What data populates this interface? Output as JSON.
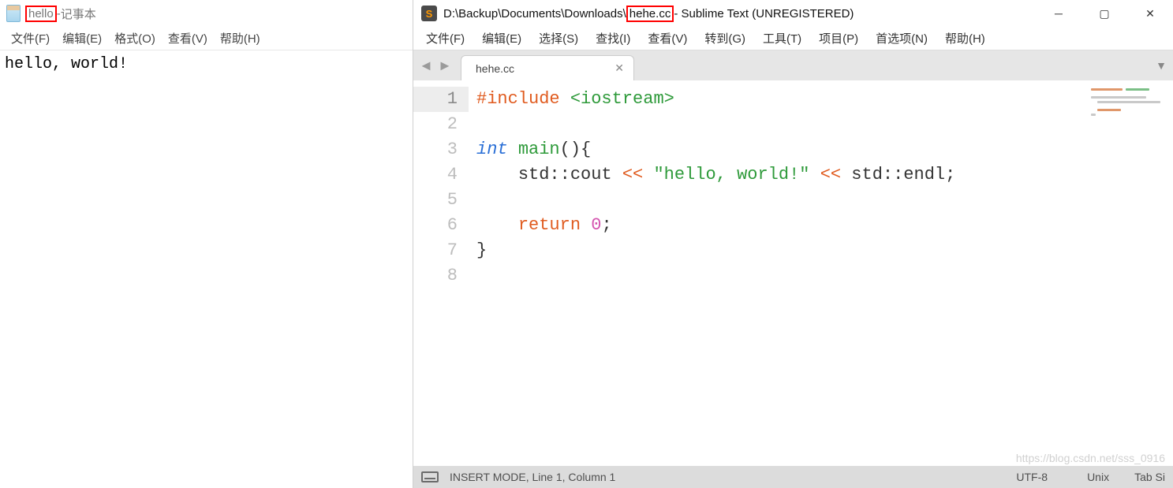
{
  "notepad": {
    "title_file": "hello",
    "title_sep": " - ",
    "title_app": "记事本",
    "menu": [
      "文件(F)",
      "编辑(E)",
      "格式(O)",
      "查看(V)",
      "帮助(H)"
    ],
    "content": "hello, world!"
  },
  "sublime": {
    "title_prefix": "D:\\Backup\\Documents\\Downloads\\",
    "title_file": "hehe.cc",
    "title_suffix": " - Sublime Text (UNREGISTERED)",
    "menu": [
      "文件(F)",
      "编辑(E)",
      "选择(S)",
      "查找(I)",
      "查看(V)",
      "转到(G)",
      "工具(T)",
      "项目(P)",
      "首选项(N)",
      "帮助(H)"
    ],
    "tab": {
      "label": "hehe.cc"
    },
    "lines": [
      "1",
      "2",
      "3",
      "4",
      "5",
      "6",
      "7",
      "8"
    ],
    "code": {
      "l1_include": "#include",
      "l1_header": "<iostream>",
      "l3_type": "int",
      "l3_func": "main",
      "l3_rest": "(){",
      "l4_indent": "    ",
      "l4_ns1": "std::cout ",
      "l4_op1": "<<",
      "l4_str": " \"hello, world!\" ",
      "l4_op2": "<<",
      "l4_ns2": " std::endl;",
      "l6_indent": "    ",
      "l6_kw": "return",
      "l6_sp": " ",
      "l6_num": "0",
      "l6_semi": ";",
      "l7_brace": "}"
    },
    "status": {
      "mode": "INSERT MODE, Line 1, Column 1",
      "encoding": "UTF-8",
      "lineending": "Unix",
      "indent": "Tab Si"
    },
    "watermark": "https://blog.csdn.net/sss_0916"
  }
}
